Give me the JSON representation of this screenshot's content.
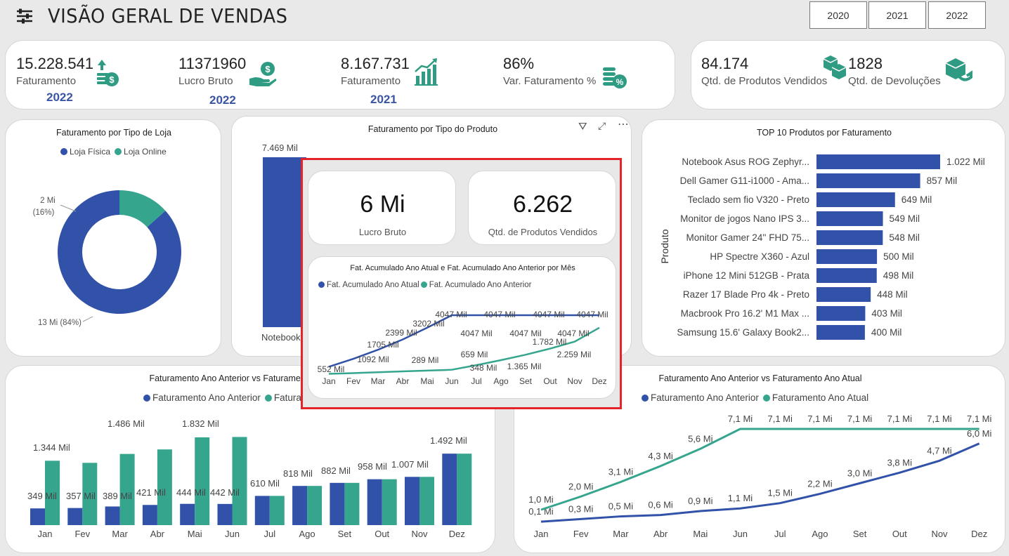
{
  "header": {
    "title": "VISÃO GERAL DE VENDAS",
    "years": [
      "2020",
      "2021",
      "2022"
    ]
  },
  "colors": {
    "blue": "#3152a8",
    "teal": "#36a58e",
    "highlight": "#e3242b"
  },
  "kpis": [
    {
      "value": "15.228.541",
      "label": "Faturamento",
      "year": "2022",
      "icon": "money-up-icon"
    },
    {
      "value": "11371960",
      "label": "Lucro Bruto",
      "year": "2022",
      "icon": "hand-coin-icon"
    },
    {
      "value": "8.167.731",
      "label": "Faturamento",
      "year": "2021",
      "icon": "growth-chart-icon"
    },
    {
      "value": "86%",
      "label": "Var. Faturamento %",
      "icon": "coins-percent-icon"
    }
  ],
  "kpis_right": [
    {
      "value": "84.174",
      "label": "Qtd. de Produtos Vendidos",
      "icon": "boxes-icon"
    },
    {
      "value": "1828",
      "label": "Qtd. de Devoluções",
      "icon": "return-box-icon"
    }
  ],
  "donut": {
    "title": "Faturamento por Tipo de Loja",
    "legend": [
      "Loja Física",
      "Loja Online"
    ],
    "label_small": "2 Mi",
    "label_small_pct": "(16%)",
    "label_big": "13 Mi (84%)"
  },
  "tipo_produto": {
    "title": "Faturamento por Tipo do Produto",
    "bar_label": "7.469 Mil",
    "cat_label": "Notebook"
  },
  "overlay": {
    "kpi1_value": "6 Mi",
    "kpi1_label": "Lucro Bruto",
    "kpi2_value": "6.262",
    "kpi2_label": "Qtd. de Produtos Vendidos",
    "chart_title": "Fat. Acumulado Ano Atual e Fat. Acumulado Ano Anterior por Mês",
    "legend": [
      "Fat. Acumulado Ano Atual",
      "Fat. Acumulado Ano Anterior"
    ]
  },
  "top10": {
    "title": "TOP 10 Produtos por Faturamento",
    "ylabel": "Produto"
  },
  "bottom_left": {
    "title": "Faturamento Ano Anterior vs Faturamento Ano Atual",
    "legend": [
      "Faturamento Ano Anterior",
      "Faturamento Ano Atual"
    ]
  },
  "bottom_right": {
    "title": "Faturamento Ano Anterior vs Faturamento Ano Atual",
    "legend": [
      "Faturamento Ano Anterior",
      "Faturamento Ano Atual"
    ]
  },
  "chart_data": [
    {
      "type": "pie",
      "title": "Faturamento por Tipo de Loja",
      "categories": [
        "Loja Física",
        "Loja Online"
      ],
      "values": [
        13,
        2
      ],
      "percent": [
        84,
        16
      ],
      "labels": [
        "13 Mi (84%)",
        "2 Mi (16%)"
      ]
    },
    {
      "type": "bar",
      "title": "Faturamento por Tipo do Produto",
      "categories": [
        "Notebook"
      ],
      "values": [
        7469
      ],
      "labels": [
        "7.469 Mil"
      ]
    },
    {
      "type": "line",
      "title": "Fat. Acumulado Ano Atual e Fat. Acumulado Ano Anterior por Mês",
      "categories": [
        "Jan",
        "Fev",
        "Mar",
        "Abr",
        "Mai",
        "Jun",
        "Jul",
        "Ago",
        "Set",
        "Out",
        "Nov",
        "Dez"
      ],
      "series": [
        {
          "name": "Fat. Acumulado Ano Atual",
          "values": [
            552,
            1092,
            1705,
            2399,
            3202,
            4047,
            4047,
            4047,
            4047,
            4047,
            4047,
            4047
          ],
          "labels": [
            "552 Mil",
            "1092 Mil",
            "1705 Mil",
            "2399 Mil",
            "3202 Mil",
            "4047 Mil",
            "4047 Mil",
            "4047 Mil",
            "4047 Mil",
            "4047 Mil",
            "4047 Mil",
            "4047 Mil"
          ]
        },
        {
          "name": "Fat. Acumulado Ano Anterior",
          "values": [
            70,
            120,
            180,
            240,
            289,
            348,
            659,
            1000,
            1365,
            1782,
            2259,
            3200
          ],
          "labels": [
            "",
            "",
            "",
            "",
            "289 Mil",
            "348 Mil",
            "659 Mil",
            "",
            "1.365 Mil",
            "1.782 Mil",
            "2.259 Mil",
            ""
          ]
        }
      ]
    },
    {
      "type": "bar",
      "orientation": "horizontal",
      "title": "TOP 10 Produtos por Faturamento",
      "ylabel": "Produto",
      "categories": [
        "Notebook Asus ROG Zephyr...",
        "Dell Gamer G11-i1000 - Ama...",
        "Teclado sem fio V320 - Preto",
        "Monitor de jogos Nano IPS 3...",
        "Monitor Gamer 24'' FHD 75...",
        "HP Spectre X360 - Azul",
        "iPhone 12 Mini 512GB - Prata",
        "Razer 17 Blade Pro 4k - Preto",
        "Macbrook Pro 16.2' M1 Max ...",
        "Samsung 15.6' Galaxy Book2..."
      ],
      "values": [
        1022,
        857,
        649,
        549,
        548,
        500,
        498,
        448,
        403,
        400
      ],
      "labels": [
        "1.022 Mil",
        "857 Mil",
        "649 Mil",
        "549 Mil",
        "548 Mil",
        "500 Mil",
        "498 Mil",
        "448 Mil",
        "403 Mil",
        "400 Mil"
      ]
    },
    {
      "type": "bar",
      "title": "Faturamento Ano Anterior vs Faturamento Ano Atual",
      "categories": [
        "Jan",
        "Fev",
        "Mar",
        "Abr",
        "Mai",
        "Jun",
        "Jul",
        "Ago",
        "Set",
        "Out",
        "Nov",
        "Dez"
      ],
      "series": [
        {
          "name": "Faturamento Ano Anterior",
          "values": [
            349,
            357,
            389,
            421,
            444,
            442,
            610,
            818,
            882,
            958,
            1007,
            1492
          ]
        },
        {
          "name": "Faturamento Ano Atual",
          "values": [
            1344,
            1300,
            1486,
            1580,
            1832,
            1840,
            610,
            818,
            882,
            958,
            1007,
            1492
          ]
        }
      ],
      "labels": [
        "349 Mil",
        "1.344 Mil",
        "357 Mil",
        "389 Mil",
        "1.486 Mil",
        "421 Mil",
        "444 Mil",
        "1.832 Mil",
        "442 Mil",
        "610 Mil",
        "818 Mil",
        "882 Mil",
        "958 Mil",
        "1.007 Mil",
        "1.492 Mil"
      ]
    },
    {
      "type": "line",
      "title": "Faturamento Ano Anterior vs Faturamento Ano Atual",
      "categories": [
        "Jan",
        "Fev",
        "Mar",
        "Abr",
        "Mai",
        "Jun",
        "Jul",
        "Ago",
        "Set",
        "Out",
        "Nov",
        "Dez"
      ],
      "series": [
        {
          "name": "Faturamento Ano Anterior",
          "values": [
            0.1,
            0.3,
            0.5,
            0.6,
            0.9,
            1.1,
            1.5,
            2.2,
            3.0,
            3.8,
            4.7,
            6.0
          ],
          "labels": [
            "0,1 Mi",
            "0,3 Mi",
            "0,5 Mi",
            "0,6 Mi",
            "0,9 Mi",
            "1,1 Mi",
            "1,5 Mi",
            "2,2 Mi",
            "3,0 Mi",
            "3,8 Mi",
            "4,7 Mi",
            "6,0 Mi"
          ]
        },
        {
          "name": "Faturamento Ano Atual",
          "values": [
            1.0,
            2.0,
            3.1,
            4.3,
            5.6,
            7.1,
            7.1,
            7.1,
            7.1,
            7.1,
            7.1,
            7.1
          ],
          "labels": [
            "1,0 Mi",
            "2,0 Mi",
            "3,1 Mi",
            "4,3 Mi",
            "5,6 Mi",
            "7,1 Mi",
            "7,1 Mi",
            "7,1 Mi",
            "7,1 Mi",
            "7,1 Mi",
            "7,1 Mi",
            "7,1 Mi"
          ]
        }
      ]
    }
  ]
}
